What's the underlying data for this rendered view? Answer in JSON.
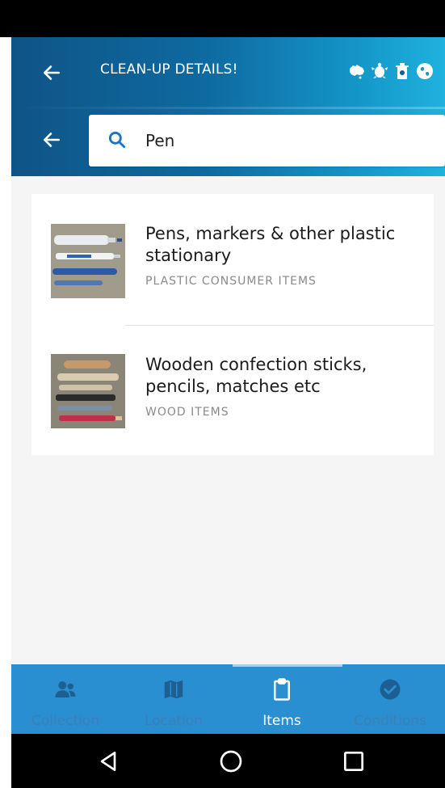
{
  "header": {
    "title": "CLEAN-UP DETAILS!",
    "logos": [
      "australia-map-icon",
      "turtle-icon",
      "bin-icon",
      "globe-icon"
    ]
  },
  "search": {
    "value": "Pen",
    "placeholder": ""
  },
  "results": [
    {
      "title": "Pens, markers & other plastic stationary",
      "category": "PLASTIC CONSUMER ITEMS",
      "image": "pens-markers-photo"
    },
    {
      "title": "Wooden confection sticks, pencils, matches etc",
      "category": "WOOD ITEMS",
      "image": "wooden-sticks-photo"
    }
  ],
  "bottom_nav": {
    "tabs": [
      {
        "label": "Collection",
        "icon": "people-icon",
        "active": false
      },
      {
        "label": "Location",
        "icon": "map-icon",
        "active": false
      },
      {
        "label": "Items",
        "icon": "clipboard-icon",
        "active": true
      },
      {
        "label": "Conditions",
        "icon": "check-circle-icon",
        "active": false
      }
    ]
  },
  "colors": {
    "header_start": "#0f5486",
    "header_end": "#1fb2de",
    "bottom_nav": "#2a8fd0",
    "search_icon": "#1a73c6"
  }
}
